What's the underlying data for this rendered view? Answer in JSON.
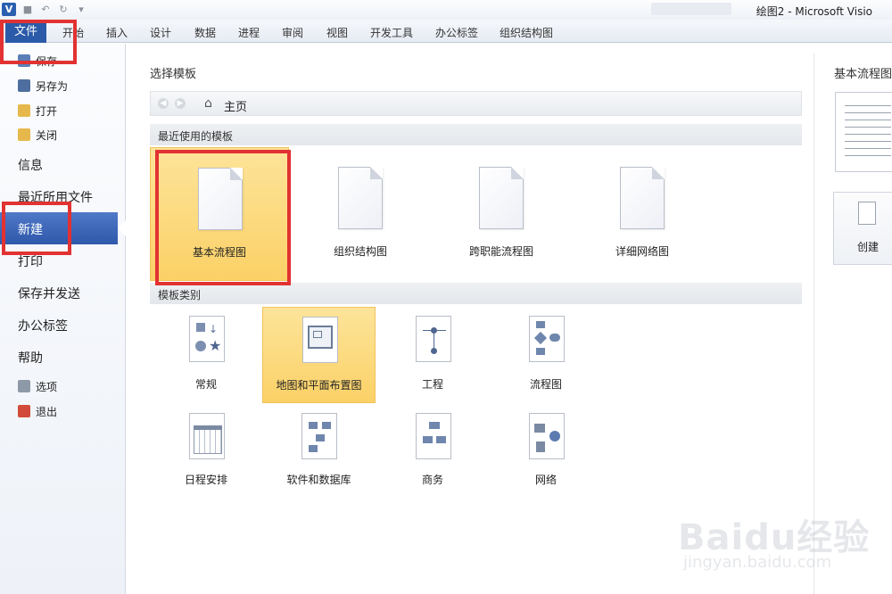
{
  "window": {
    "app_icon_letter": "V",
    "title": "绘图2 - Microsoft Visio"
  },
  "ribbon": {
    "file_tab": "文件",
    "tabs": [
      "开始",
      "插入",
      "设计",
      "数据",
      "进程",
      "审阅",
      "视图",
      "开发工具",
      "办公标签",
      "组织结构图"
    ]
  },
  "nav": {
    "save": "保存",
    "save_as": "另存为",
    "open": "打开",
    "close": "关闭",
    "info": "信息",
    "recent": "最近所用文件",
    "new": "新建",
    "print": "打印",
    "save_send": "保存并发送",
    "office_tab": "办公标签",
    "help": "帮助",
    "options": "选项",
    "exit": "退出"
  },
  "main": {
    "title": "选择模板",
    "breadcrumb_home": "主页",
    "recent_header": "最近使用的模板",
    "recent_templates": [
      "基本流程图",
      "组织结构图",
      "跨职能流程图",
      "详细网络图"
    ],
    "category_header": "模板类别",
    "categories": [
      "常规",
      "地图和平面布置图",
      "工程",
      "流程图",
      "日程安排",
      "软件和数据库",
      "商务",
      "网络"
    ]
  },
  "preview": {
    "title": "基本流程图",
    "create_label": "创建"
  },
  "watermark": {
    "brand": "Baidu经验",
    "url": "jingyan.baidu.com"
  },
  "colors": {
    "accent": "#2b5aa8",
    "highlight": "#e23232",
    "selected_tile": "#fbd167"
  }
}
